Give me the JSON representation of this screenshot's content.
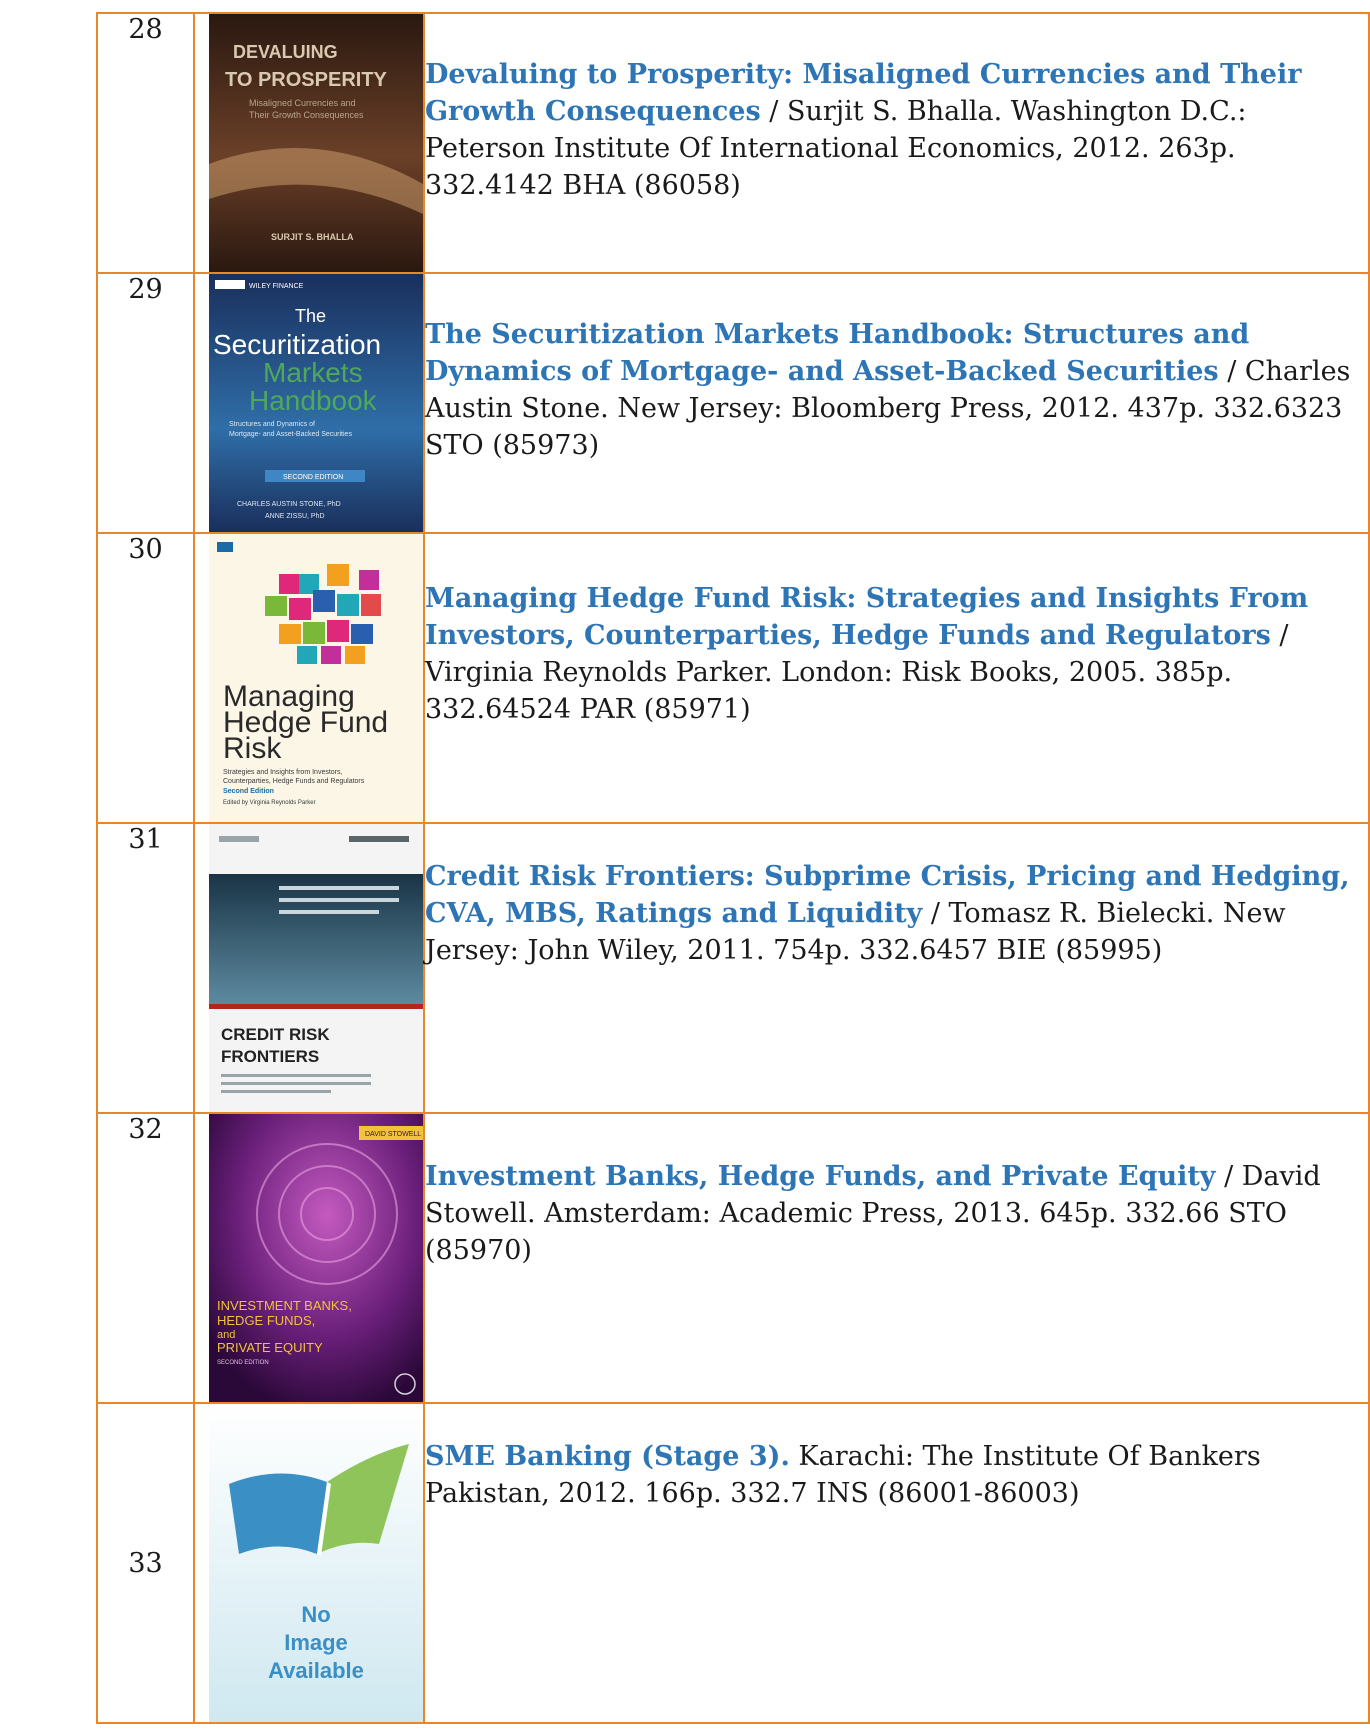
{
  "rows": [
    {
      "number": "28",
      "title": "Devaluing to Prosperity: Misaligned Currencies and Their Growth Consequences",
      "rest": " / Surjit S. Bhalla. Washington D.C.: Peterson Institute Of International Economics, 2012. 263p. 332.4142 BHA (86058)",
      "cover": {
        "line1": "DEVALUING",
        "line2": "TO PROSPERITY",
        "subtitle1": "Misaligned Currencies and",
        "subtitle2": "Their Growth Consequences",
        "author": "SURJIT S. BHALLA",
        "colors": [
          "#3b2418",
          "#8a5a3a",
          "#c89a6a"
        ]
      }
    },
    {
      "number": "29",
      "title": "The Securitization Markets Handbook: Structures and Dynamics of Mortgage- and Asset-Backed Securities",
      "rest": " / Charles Austin Stone. New Jersey: Bloomberg Press, 2012. 437p. 332.6323 STO (85973)",
      "cover": {
        "publisher": "WILEY FINANCE",
        "line1": "The",
        "line2": "Securitization",
        "line3": "Markets",
        "line4": "Handbook",
        "subtitle1": "Structures and Dynamics of",
        "subtitle2": "Mortgage- and Asset-Backed Securities",
        "edition": "SECOND EDITION",
        "author1": "CHARLES AUSTIN STONE, PhD",
        "author2": "ANNE ZISSU, PhD",
        "colors": [
          "#1f3b73",
          "#2f7bb8",
          "#3a8a5a"
        ]
      }
    },
    {
      "number": "30",
      "title": "Managing Hedge Fund Risk: Strategies and Insights From Investors, Counterparties, Hedge Funds and Regulators",
      "rest": " / Virginia Reynolds Parker. London: Risk Books, 2005. 385p. 332.64524 PAR (85971)",
      "cover": {
        "line1": "Managing",
        "line2": "Hedge Fund",
        "line3": "Risk",
        "subtitle1": "Strategies and Insights from Investors,",
        "subtitle2": "Counterparties, Hedge Funds and Regulators",
        "edition": "Second Edition",
        "editor": "Edited by Virginia Reynolds Parker",
        "colors": [
          "#fbf6e6",
          "#e0287a",
          "#21a7b8",
          "#7ab83a",
          "#f2a01e"
        ]
      }
    },
    {
      "number": "31",
      "title": "Credit Risk Frontiers: Subprime Crisis, Pricing and Hedging, CVA, MBS, Ratings and Liquidity",
      "rest": " / Tomasz R. Bielecki. New Jersey: John Wiley, 2011. 754p. 332.6457 BIE (85995)",
      "cover": {
        "line1": "CREDIT RISK",
        "line2": "FRONTIERS",
        "colors": [
          "#f2f2f2",
          "#1f3b50",
          "#5d8aa0"
        ]
      }
    },
    {
      "number": "32",
      "title": "Investment Banks, Hedge Funds, and Private Equity",
      "rest": " / David Stowell. Amsterdam: Academic Press, 2013. 645p. 332.66 STO (85970)",
      "cover": {
        "author": "DAVID STOWELL",
        "line1": "INVESTMENT BANKS,",
        "line2": "HEDGE FUNDS,",
        "line3": "and",
        "line4": "PRIVATE EQUITY",
        "edition": "SECOND EDITION",
        "colors": [
          "#3a0e52",
          "#8a2b8a",
          "#f2c23a"
        ]
      }
    },
    {
      "number": "33",
      "title": "SME Banking (Stage 3).",
      "rest": " Karachi: The Institute Of Bankers Pakistan, 2012. 166p. 332.7 INS (86001-86003)",
      "cover": {
        "line1": "No",
        "line2": "Image",
        "line3": "Available",
        "colors": [
          "#e6f3f7",
          "#3a8fc4",
          "#8fc45a"
        ]
      }
    }
  ]
}
